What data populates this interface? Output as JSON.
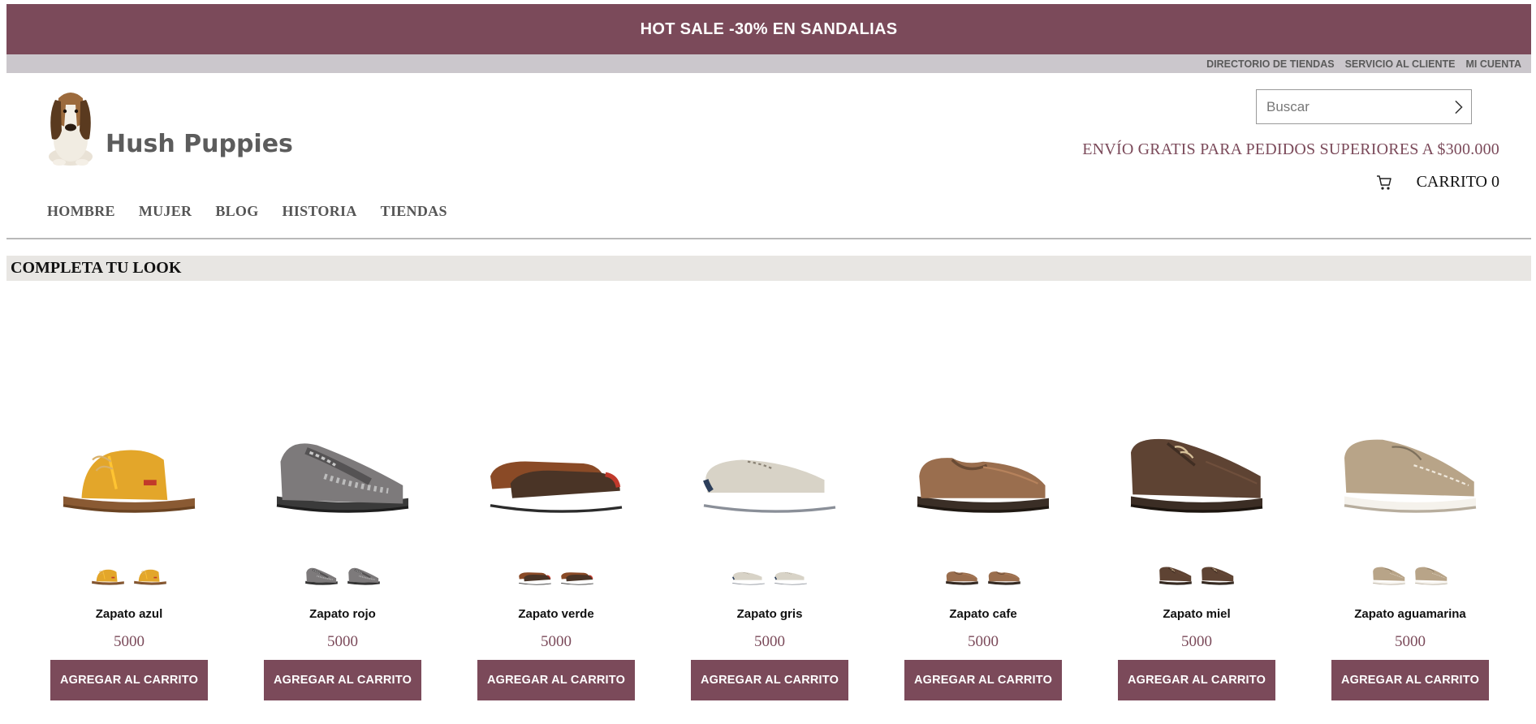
{
  "promo": {
    "text": "HOT SALE -30% EN SANDALIAS"
  },
  "utility_links": [
    "DIRECTORIO DE TIENDAS",
    "SERVICIO AL CLIENTE",
    "MI CUENTA"
  ],
  "brand": {
    "name": "Hush Puppies",
    "logo_icon": "basset-hound-logo"
  },
  "search": {
    "placeholder": "Buscar",
    "icon": "chevron-right-icon"
  },
  "shipping_notice": "ENVÍO GRATIS PARA PEDIDOS SUPERIORES A $300.000",
  "cart": {
    "label": "CARRITO 0",
    "icon": "cart-icon"
  },
  "nav": [
    "HOMBRE",
    "MUJER",
    "BLOG",
    "HISTORIA",
    "TIENDAS"
  ],
  "section_title": "COMPLETA TU LOOK",
  "products": [
    {
      "name": "Zapato azul",
      "price": "5000",
      "button": "AGREGAR AL CARRITO",
      "color": "#e3a62a",
      "style": "boot"
    },
    {
      "name": "Zapato rojo",
      "price": "5000",
      "button": "AGREGAR AL CARRITO",
      "color": "#7d7a7b",
      "style": "sneaker"
    },
    {
      "name": "Zapato verde",
      "price": "5000",
      "button": "AGREGAR AL CARRITO",
      "color": "#4a3426",
      "style": "pair"
    },
    {
      "name": "Zapato gris",
      "price": "5000",
      "button": "AGREGAR AL CARRITO",
      "color": "#d8d3c7",
      "style": "canvas"
    },
    {
      "name": "Zapato cafe",
      "price": "5000",
      "button": "AGREGAR AL CARRITO",
      "color": "#9a6e4e",
      "style": "loafer"
    },
    {
      "name": "Zapato miel",
      "price": "5000",
      "button": "AGREGAR AL CARRITO",
      "color": "#5e4333",
      "style": "oxford"
    },
    {
      "name": "Zapato aguamarina",
      "price": "5000",
      "button": "AGREGAR AL CARRITO",
      "color": "#b8a488",
      "style": "moccasin"
    }
  ],
  "colors": {
    "brand": "#7b4a5a",
    "utility_bar": "#cbc7cc",
    "section_bar": "#e8e6e3"
  }
}
